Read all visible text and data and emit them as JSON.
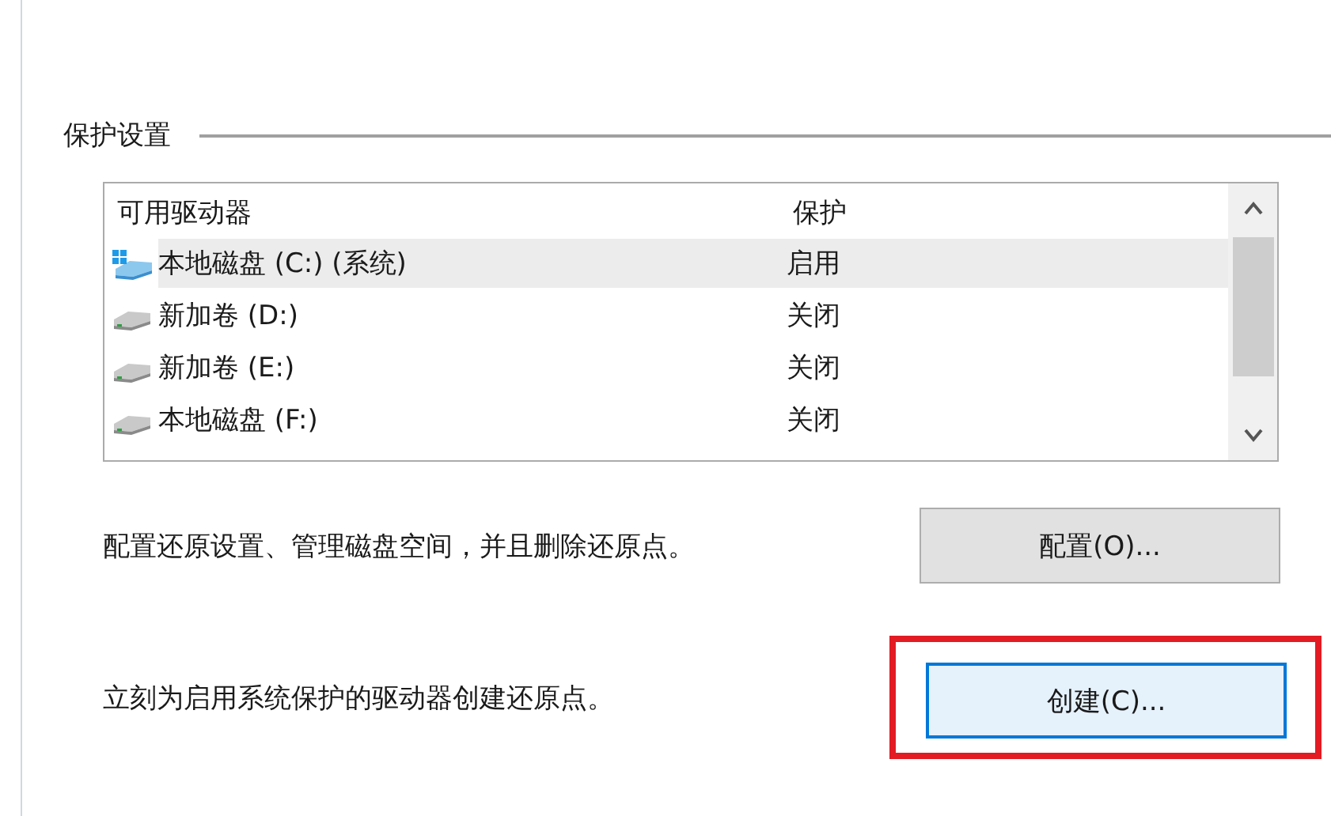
{
  "group": {
    "title": "保护设置"
  },
  "drives": {
    "columns": [
      "可用驱动器",
      "保护"
    ],
    "rows": [
      {
        "kind": "system",
        "name": "本地磁盘 (C:) (系统)",
        "protection": "启用",
        "selected": true
      },
      {
        "kind": "drive",
        "name": "新加卷 (D:)",
        "protection": "关闭",
        "selected": false
      },
      {
        "kind": "drive",
        "name": "新加卷 (E:)",
        "protection": "关闭",
        "selected": false
      },
      {
        "kind": "drive",
        "name": "本地磁盘 (F:)",
        "protection": "关闭",
        "selected": false
      }
    ]
  },
  "actions": [
    {
      "text": "配置还原设置、管理磁盘空间，并且删除还原点。",
      "button": "配置(O)...",
      "focused": false,
      "highlighted": false
    },
    {
      "text": "立刻为启用系统保护的驱动器创建还原点。",
      "button": "创建(C)...",
      "focused": true,
      "highlighted": true
    }
  ]
}
